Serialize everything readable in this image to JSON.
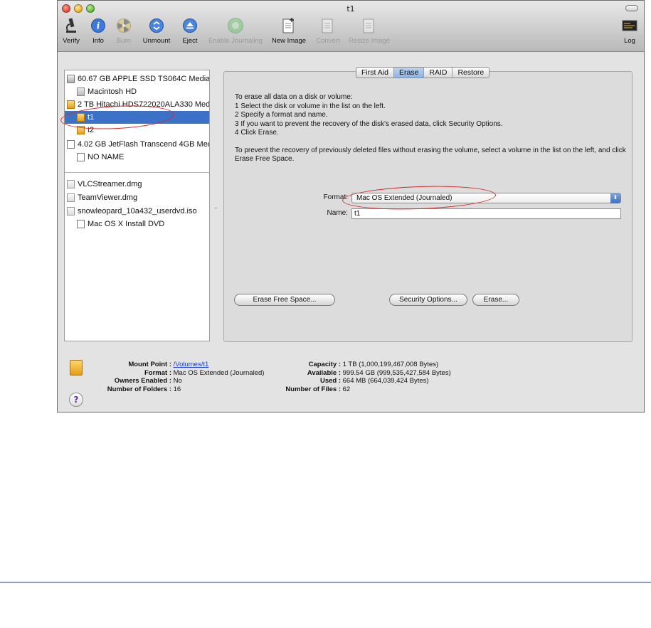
{
  "window": {
    "title": "t1"
  },
  "toolbar": {
    "items": [
      {
        "label": "Verify",
        "icon": "microscope-icon",
        "enabled": true
      },
      {
        "label": "Info",
        "icon": "info-icon",
        "enabled": true
      },
      {
        "label": "Burn",
        "icon": "burn-icon",
        "enabled": false
      },
      {
        "label": "Unmount",
        "icon": "unmount-icon",
        "enabled": true
      },
      {
        "label": "Eject",
        "icon": "eject-icon",
        "enabled": true
      },
      {
        "label": "Enable Journaling",
        "icon": "journaling-icon",
        "enabled": false
      },
      {
        "label": "New Image",
        "icon": "new-image-icon",
        "enabled": true
      },
      {
        "label": "Convert",
        "icon": "convert-icon",
        "enabled": false
      },
      {
        "label": "Resize Image",
        "icon": "resize-image-icon",
        "enabled": false
      },
      {
        "label": "Log",
        "icon": "log-icon",
        "enabled": true
      }
    ]
  },
  "sidebar": {
    "disks": [
      {
        "label": "60.67 GB APPLE SSD TS064C Media",
        "kind": "disk"
      },
      {
        "label": "Macintosh HD",
        "kind": "volume"
      },
      {
        "label": "2 TB Hitachi HDS722020ALA330 Med",
        "kind": "disk-orange"
      },
      {
        "label": "t1",
        "kind": "volume-orange",
        "selected": true
      },
      {
        "label": "t2",
        "kind": "volume-orange"
      },
      {
        "label": "4.02 GB JetFlash Transcend 4GB Med",
        "kind": "disk-blank"
      },
      {
        "label": "NO NAME",
        "kind": "volume-blank"
      }
    ],
    "images": [
      {
        "label": "VLCStreamer.dmg"
      },
      {
        "label": "TeamViewer.dmg"
      },
      {
        "label": "snowleopard_10a432_userdvd.iso"
      },
      {
        "label": "Mac OS X Install DVD"
      }
    ]
  },
  "tabs": [
    "First Aid",
    "Erase",
    "RAID",
    "Restore"
  ],
  "active_tab": "Erase",
  "erase": {
    "instructions_intro": "To erase all data on a disk or volume:",
    "steps": [
      "1 Select the disk or volume in the list on the left.",
      "2 Specify a format and name.",
      "3 If you want to prevent the recovery of the disk's erased data, click Security Options.",
      "4 Click Erase."
    ],
    "free_space_note": "To prevent the recovery of previously deleted files without erasing the volume, select a volume in the list on the left, and click Erase Free Space.",
    "format_label": "Format:",
    "format_value": "Mac OS Extended (Journaled)",
    "name_label": "Name:",
    "name_value": "t1",
    "erase_free_space_button": "Erase Free Space...",
    "security_options_button": "Security Options...",
    "erase_button": "Erase..."
  },
  "info": {
    "mount_point_label": "Mount Point :",
    "mount_point_value": "/Volumes/t1",
    "format_label": "Format :",
    "format_value": "Mac OS Extended (Journaled)",
    "owners_label": "Owners Enabled :",
    "owners_value": "No",
    "folders_label": "Number of Folders :",
    "folders_value": "16",
    "capacity_label": "Capacity :",
    "capacity_value": "1 TB (1,000,199,467,008 Bytes)",
    "available_label": "Available :",
    "available_value": "999.54 GB (999,535,427,584 Bytes)",
    "used_label": "Used :",
    "used_value": "664 MB (664,039,424 Bytes)",
    "files_label": "Number of Files :",
    "files_value": "62"
  },
  "colors": {
    "selection": "#3b72c8",
    "annotation": "#d12a2a",
    "link": "#1a3ec8"
  }
}
